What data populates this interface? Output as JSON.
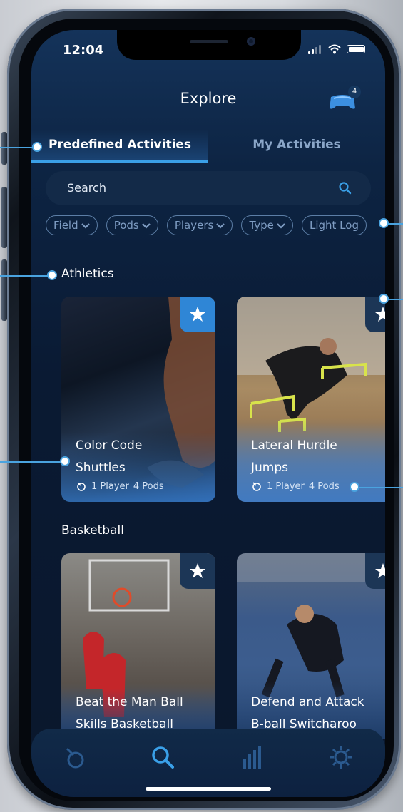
{
  "status": {
    "time": "12:04"
  },
  "header": {
    "title": "Explore",
    "pods_badge": "4"
  },
  "tabs": [
    {
      "label": "Predefined Activities",
      "active": true
    },
    {
      "label": "My Activities",
      "active": false
    }
  ],
  "search": {
    "placeholder": "Search"
  },
  "filters": [
    "Field",
    "Pods",
    "Players",
    "Type",
    "Light Log"
  ],
  "sections": [
    {
      "title": "Athletics",
      "cards": [
        {
          "title_line1": "Color Code",
          "title_line2": "Shuttles",
          "players": "1 Player",
          "pods": "4 Pods",
          "starred": true
        },
        {
          "title_line1": "Lateral Hurdle",
          "title_line2": "Jumps",
          "players": "1 Player",
          "pods": "4 Pods",
          "starred": false
        }
      ]
    },
    {
      "title": "Basketball",
      "cards": [
        {
          "title_line1": "Beat the Man Ball",
          "title_line2": "Skills Basketball",
          "starred": false
        },
        {
          "title_line1": "Defend and Attack",
          "title_line2": "B-ball Switcharoo",
          "starred": false
        }
      ]
    }
  ],
  "bottom_nav": [
    "pods-nav-icon",
    "search-nav-icon",
    "stats-nav-icon",
    "settings-nav-icon"
  ],
  "colors": {
    "accent": "#3aa0e8",
    "background": "#0d2443",
    "star_badge_active": "#2f86d6",
    "star_badge": "#1c3656"
  }
}
